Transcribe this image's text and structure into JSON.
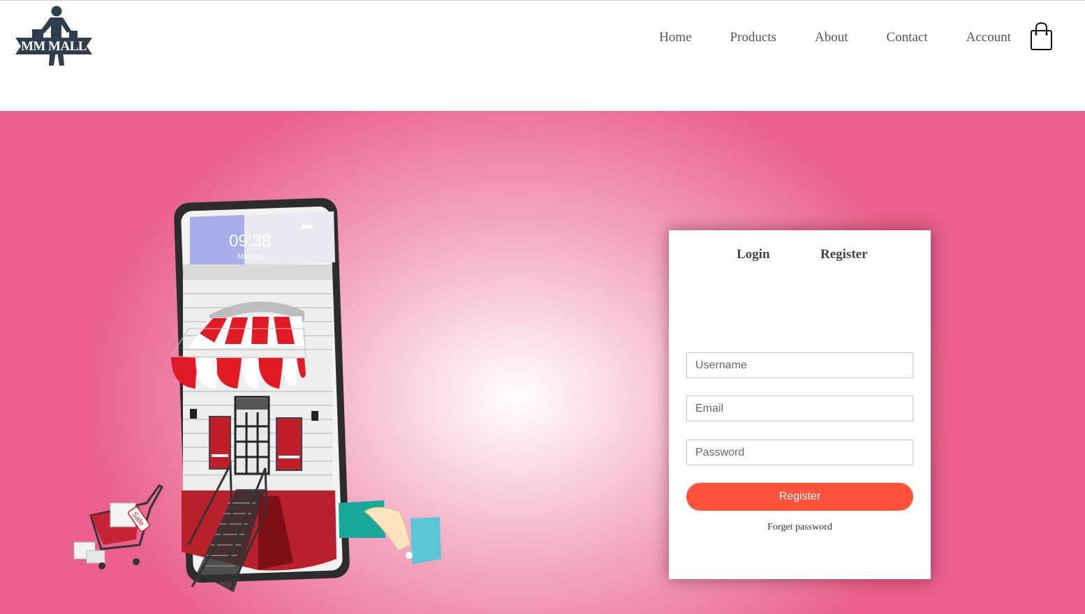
{
  "brand": {
    "logo_text": "MM MALL"
  },
  "nav": {
    "items": [
      {
        "label": "Home"
      },
      {
        "label": "Products"
      },
      {
        "label": "About"
      },
      {
        "label": "Contact"
      },
      {
        "label": "Account"
      }
    ]
  },
  "illustration": {
    "phone_time": "09:38",
    "phone_day": "Monday",
    "tag_text": "Sale"
  },
  "form": {
    "tabs": {
      "login": "Login",
      "register": "Register"
    },
    "username_placeholder": "Username",
    "email_placeholder": "Email",
    "password_placeholder": "Password",
    "submit_label": "Register",
    "forget_label": "Forget password"
  },
  "colors": {
    "accent": "#ff523b",
    "hero_outer": "#ea5f8d",
    "hero_center": "#ffffff"
  },
  "icons": {
    "cart": "shopping-bag-icon",
    "logo": "shopper-figure-logo"
  }
}
